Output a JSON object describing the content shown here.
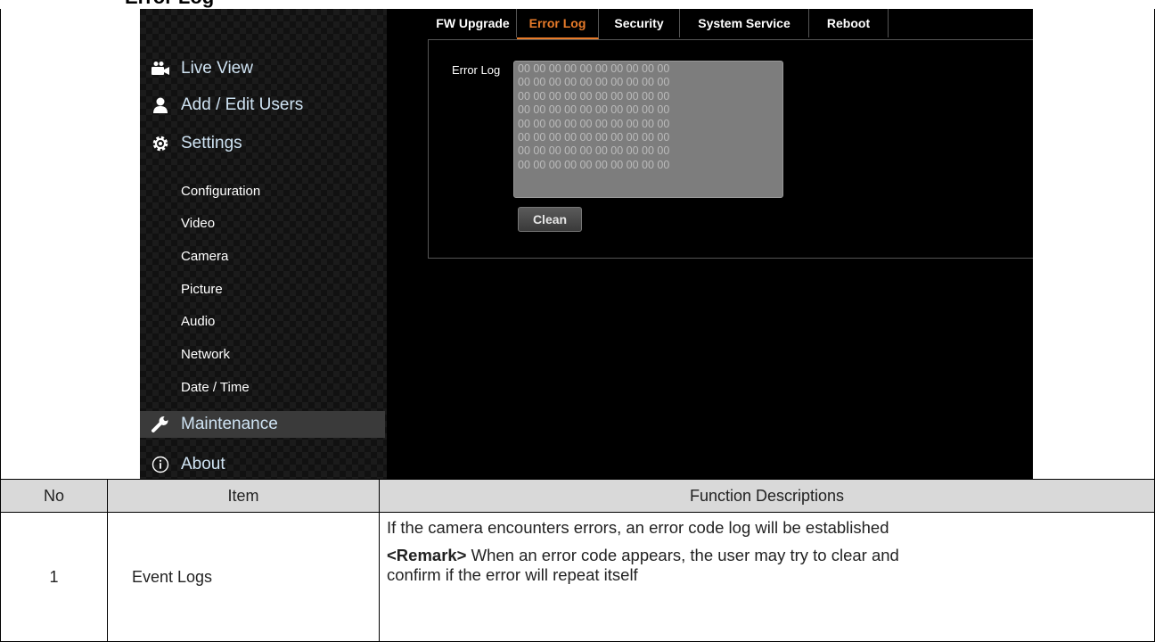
{
  "page": {
    "clipped_heading": "Error Log"
  },
  "sidebar": {
    "main_items": [
      {
        "label": "Live View",
        "icon": "video-camera-icon"
      },
      {
        "label": "Add / Edit Users",
        "icon": "user-icon"
      },
      {
        "label": "Settings",
        "icon": "gear-icon"
      }
    ],
    "sub_items": [
      "Configuration",
      "Video",
      "Camera",
      "Picture",
      "Audio",
      "Network",
      "Date / Time"
    ],
    "bottom_items": [
      {
        "label": "Maintenance",
        "icon": "wrench-icon",
        "active": true
      },
      {
        "label": "About",
        "icon": "info-icon"
      }
    ]
  },
  "tabs": [
    {
      "label": "FW Upgrade",
      "active": false
    },
    {
      "label": "Error Log",
      "active": true
    },
    {
      "label": "Security",
      "active": false
    },
    {
      "label": "System Service",
      "active": false
    },
    {
      "label": "Reboot",
      "active": false
    }
  ],
  "error_log": {
    "label": "Error Log",
    "lines": [
      "00 00 00 00 00 00 00 00 00 00",
      "00 00 00 00 00 00 00 00 00 00",
      "00 00 00 00 00 00 00 00 00 00",
      "00 00 00 00 00 00 00 00 00 00",
      "00 00 00 00 00 00 00 00 00 00",
      "00 00 00 00 00 00 00 00 00 00",
      "00 00 00 00 00 00 00 00 00 00",
      "00 00 00 00 00 00 00 00 00 00"
    ],
    "clean_button": "Clean"
  },
  "table": {
    "headers": {
      "no": "No",
      "item": "Item",
      "function": "Function Descriptions"
    },
    "rows": [
      {
        "no": "1",
        "item": "Event Logs",
        "line1": "If the camera encounters errors, an error code log will be established",
        "remark_label": "<Remark>",
        "remark_text": " When an error code appears, the user may try to clear and",
        "line3": "confirm if the error will repeat itself"
      }
    ]
  },
  "colors": {
    "accent": "#e87b2a",
    "nav_text": "#cfe3f3",
    "log_box": "#7d7d7d",
    "header_bg": "#d9d9d9"
  }
}
